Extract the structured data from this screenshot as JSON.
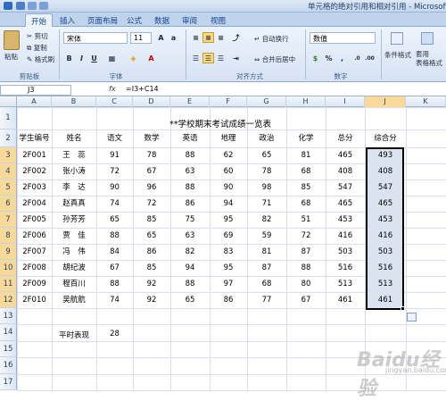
{
  "window": {
    "title": "单元格的绝对引用和相对引用 - Microsoft Excel"
  },
  "tabs": [
    "开始",
    "插入",
    "页面布局",
    "公式",
    "数据",
    "审阅",
    "视图"
  ],
  "ribbon": {
    "paste_label": "粘贴",
    "cut_label": "剪切",
    "copy_label": "复制",
    "format_painter_label": "格式刷",
    "clipboard_group": "剪贴板",
    "font_name": "宋体",
    "font_size": "11",
    "font_group": "字体",
    "bold": "B",
    "italic": "I",
    "underline": "U",
    "wrap_text_label": "自动换行",
    "merge_center_label": "合并后居中",
    "alignment_group": "对齐方式",
    "number_format": "数值",
    "number_group": "数字",
    "conditional_format_label": "条件格式",
    "table_format_label": "套用\n表格格式"
  },
  "formula_bar": {
    "name_box": "J3",
    "fx": "fx",
    "formula": "=I3+C14"
  },
  "columns": [
    "A",
    "B",
    "C",
    "D",
    "E",
    "F",
    "G",
    "H",
    "I",
    "J",
    "K"
  ],
  "rows": [
    "1",
    "2",
    "3",
    "4",
    "5",
    "6",
    "7",
    "8",
    "9",
    "10",
    "11",
    "12",
    "13",
    "14",
    "15",
    "16",
    "17"
  ],
  "sheet": {
    "title": "**学校期末考试成绩一览表",
    "headers": [
      "学生编号",
      "姓名",
      "语文",
      "数学",
      "英语",
      "地理",
      "政治",
      "化学",
      "总分",
      "综合分"
    ],
    "records": [
      [
        "2F001",
        "王　蕊",
        "91",
        "78",
        "88",
        "62",
        "65",
        "81",
        "465",
        "493"
      ],
      [
        "2F002",
        "张小涛",
        "72",
        "67",
        "63",
        "60",
        "78",
        "68",
        "408",
        "408"
      ],
      [
        "2F003",
        "李　达",
        "90",
        "96",
        "88",
        "90",
        "98",
        "85",
        "547",
        "547"
      ],
      [
        "2F004",
        "赵真真",
        "74",
        "72",
        "86",
        "94",
        "71",
        "68",
        "465",
        "465"
      ],
      [
        "2F005",
        "孙芳芳",
        "65",
        "85",
        "75",
        "95",
        "82",
        "51",
        "453",
        "453"
      ],
      [
        "2F006",
        "贾　佳",
        "88",
        "65",
        "63",
        "69",
        "59",
        "72",
        "416",
        "416"
      ],
      [
        "2F007",
        "冯　伟",
        "84",
        "86",
        "82",
        "83",
        "81",
        "87",
        "503",
        "503"
      ],
      [
        "2F008",
        "胡纪波",
        "67",
        "85",
        "94",
        "95",
        "87",
        "88",
        "516",
        "516"
      ],
      [
        "2F009",
        "程百川",
        "88",
        "92",
        "88",
        "97",
        "68",
        "80",
        "513",
        "513"
      ],
      [
        "2F010",
        "吴航航",
        "74",
        "92",
        "65",
        "86",
        "77",
        "67",
        "461",
        "461"
      ]
    ],
    "extra_label": "平时表现",
    "extra_value": "28"
  },
  "watermark": {
    "text": "Baidu经验",
    "sub": "jingyan.baidu.com"
  },
  "colors": {
    "selection_fill": "#dbe3f0",
    "active_header": "#f9d99a",
    "ribbon_bg": "#d6e3f4"
  }
}
